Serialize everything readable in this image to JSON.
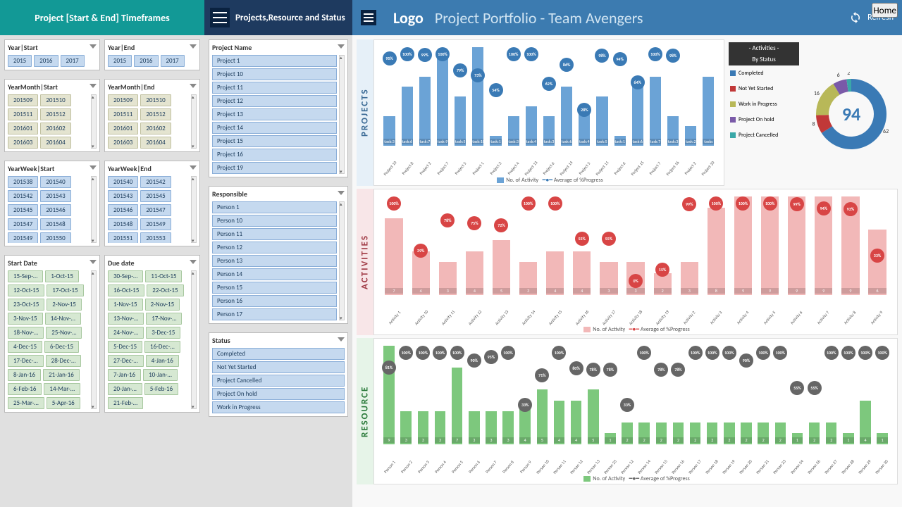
{
  "header": {
    "left_title": "Project [Start & End] Timeframes",
    "mid_title": "Projects,Resource and Status",
    "logo": "Logo",
    "main_title": "Project Portfolio - Team Avengers",
    "refresh": "Refresh",
    "home": "Home"
  },
  "slicers": {
    "year_start": {
      "label": "Year|Start",
      "items": [
        "2015",
        "2016",
        "2017"
      ]
    },
    "year_end": {
      "label": "Year|End",
      "items": [
        "2015",
        "2016",
        "2017"
      ]
    },
    "yearmonth_start": {
      "label": "YearMonth|Start",
      "items": [
        "201509",
        "201510",
        "201511",
        "201512",
        "201601",
        "201602",
        "201603",
        "201604"
      ]
    },
    "yearmonth_end": {
      "label": "YearMonth|End",
      "items": [
        "201509",
        "201510",
        "201511",
        "201512",
        "201601",
        "201602",
        "201603",
        "201604"
      ]
    },
    "yearweek_start": {
      "label": "YearWeek|Start",
      "items": [
        "201538",
        "201540",
        "201542",
        "201543",
        "201545",
        "201546",
        "201547",
        "201548",
        "201549",
        "201550"
      ]
    },
    "yearweek_end": {
      "label": "YearWeek|End",
      "items": [
        "201540",
        "201542",
        "201543",
        "201545",
        "201546",
        "201547",
        "201548",
        "201549",
        "201551",
        "201553"
      ]
    },
    "start_date": {
      "label": "Start Date",
      "items": [
        "15-Sep-…",
        "1-Oct-15",
        "12-Oct-15",
        "17-Oct-15",
        "23-Oct-15",
        "2-Nov-15",
        "3-Nov-15",
        "14-Nov-…",
        "18-Nov-…",
        "25-Nov-…",
        "4-Dec-15",
        "6-Dec-15",
        "17-Dec-…",
        "28-Dec-…",
        "8-Jan-16",
        "21-Jan-16",
        "6-Feb-16",
        "14-Mar-…",
        "25-Mar-…",
        "5-Apr-16"
      ]
    },
    "due_date": {
      "label": "Due date",
      "items": [
        "30-Sep-…",
        "11-Oct-15",
        "16-Oct-15",
        "22-Oct-15",
        "1-Nov-15",
        "2-Nov-15",
        "13-Nov-…",
        "17-Nov-…",
        "24-Nov-…",
        "3-Dec-15",
        "5-Dec-15",
        "16-Dec-…",
        "27-Dec-…",
        "4-Jan-16",
        "7-Jan-16",
        "10-Jan-…",
        "20-Jan-…",
        "5-Feb-16",
        "21-Feb-…"
      ]
    },
    "project": {
      "label": "Project Name",
      "items": [
        "Project 1",
        "Project 10",
        "Project 11",
        "Project 12",
        "Project 13",
        "Project 14",
        "Project 15",
        "Project 16",
        "Project 19"
      ]
    },
    "responsible": {
      "label": "Responsible",
      "items": [
        "Person 1",
        "Person 10",
        "Person 11",
        "Person 12",
        "Person 13",
        "Person 14",
        "Person 15",
        "Person 16",
        "Person 17"
      ]
    },
    "status": {
      "label": "Status",
      "items": [
        "Completed",
        "Not Yet Started",
        "Project Cancelled",
        "Project On hold",
        "Work in Progress"
      ]
    }
  },
  "sections": {
    "projects": "PROJECTS",
    "activities": "ACTIVITIES",
    "resource": "RESOURCE"
  },
  "legend_side": {
    "title1": "- Activities -",
    "title2": "By Status",
    "items": [
      {
        "label": "Completed",
        "color": "#3a7ab5"
      },
      {
        "label": "Not Yet Started",
        "color": "#c13838"
      },
      {
        "label": "Work in Progress",
        "color": "#b8b858"
      },
      {
        "label": "Project On hold",
        "color": "#7a5aa8"
      },
      {
        "label": "Project Cancelled",
        "color": "#3aa8a8"
      }
    ]
  },
  "donut": {
    "center": "94",
    "slices": [
      {
        "value": 62,
        "color": "#3a7ab5"
      },
      {
        "value": 8,
        "color": "#c13838"
      },
      {
        "value": 16,
        "color": "#b8b858"
      },
      {
        "value": 6,
        "color": "#7a5aa8"
      },
      {
        "value": 2,
        "color": "#3aa8a8"
      }
    ]
  },
  "legend_chart": {
    "bars": "No. of Activity",
    "line": "Average of %Progress"
  },
  "chart_data": [
    {
      "type": "bar",
      "title": "Projects",
      "series": [
        {
          "name": "No. of Activity",
          "values": [
            3,
            6,
            7,
            9,
            5,
            10,
            1,
            3,
            4,
            3,
            6,
            4,
            5,
            1,
            6,
            7,
            3,
            2,
            7
          ]
        },
        {
          "name": "Average of %Progress",
          "values": [
            95,
            100,
            99,
            100,
            79,
            73,
            54,
            100,
            100,
            62,
            86,
            28,
            98,
            94,
            64,
            100,
            98,
            null,
            null
          ]
        }
      ],
      "categories": [
        "Project 10",
        "Project 8",
        "Project 2",
        "Project 7",
        "Project 5",
        "Project 1",
        "Project 3",
        "Project 4",
        "Project 13",
        "Project 6",
        "Project 14",
        "Project 5",
        "Project 11",
        "Project 6",
        "Project 15",
        "Project 7",
        "Project 16",
        "Project 2",
        "Project 20"
      ],
      "bar_labels": [
        "task:3",
        "task:6",
        "task:7",
        "task:9",
        "task:5",
        "task:10",
        "task:1",
        "task:3",
        "task:4",
        "task:3",
        "task:6",
        "task:4",
        "task:5",
        "task:1",
        "task:6",
        "task:7",
        "task:3",
        "task:2",
        "tasks"
      ],
      "ylim": [
        0,
        10
      ]
    },
    {
      "type": "bar",
      "title": "Activities",
      "series": [
        {
          "name": "No. of Activity",
          "values": [
            7,
            4,
            3,
            4,
            5,
            3,
            4,
            4,
            3,
            3,
            2,
            3,
            8,
            9,
            9,
            9,
            9,
            9,
            6
          ]
        },
        {
          "name": "Average of %Progress",
          "values": [
            100,
            39,
            78,
            75,
            72,
            100,
            100,
            55,
            55,
            0,
            15,
            99,
            100,
            100,
            100,
            99,
            94,
            93,
            33
          ]
        }
      ],
      "categories": [
        "Activity 1",
        "Activity 10",
        "Activity 11",
        "Activity 12",
        "Activity 13",
        "Activity 14",
        "Activity 15",
        "Activity 16",
        "Activity 17",
        "Activity 18",
        "Activity 19",
        "Activity 2",
        "Activity 3",
        "Activity 4",
        "Activity 5",
        "Activity 6",
        "Activity 7",
        "Activity 8",
        "Activity 9"
      ],
      "ylim": [
        0,
        9
      ]
    },
    {
      "type": "bar",
      "title": "Resource",
      "series": [
        {
          "name": "No. of Activity",
          "values": [
            9,
            3,
            3,
            3,
            7,
            3,
            3,
            3,
            4,
            5,
            4,
            4,
            5,
            1,
            2,
            2,
            2,
            2,
            2,
            2,
            2,
            2,
            2,
            2,
            1,
            2,
            2,
            1,
            4,
            1
          ]
        },
        {
          "name": "Average of %Progress",
          "values": [
            81,
            100,
            100,
            100,
            100,
            90,
            95,
            100,
            33,
            71,
            100,
            80,
            78,
            78,
            33,
            100,
            78,
            78,
            100,
            100,
            100,
            90,
            100,
            100,
            55,
            55,
            100,
            100,
            100,
            100
          ]
        }
      ],
      "categories": [
        "Person 1",
        "Person 2",
        "Person 3",
        "Person 4",
        "Person 5",
        "Person 6",
        "Person 7",
        "Person 8",
        "Person 9",
        "Person 10",
        "Person 11",
        "Person 12",
        "Person 13",
        "Person 25",
        "Person 12",
        "Person 14",
        "Person 15",
        "Person 16",
        "Person 17",
        "Person 18",
        "Person 19",
        "Person 20",
        "Person 21",
        "Person 23",
        "Person 24",
        "Person 26",
        "Person 27",
        "Person 28",
        "Person 29",
        "Person 30"
      ],
      "ylim": [
        0,
        9
      ]
    },
    {
      "type": "pie",
      "title": "Activities By Status",
      "categories": [
        "Completed",
        "Not Yet Started",
        "Work in Progress",
        "Project On hold",
        "Project Cancelled"
      ],
      "values": [
        62,
        8,
        16,
        6,
        2
      ],
      "total": 94
    }
  ]
}
